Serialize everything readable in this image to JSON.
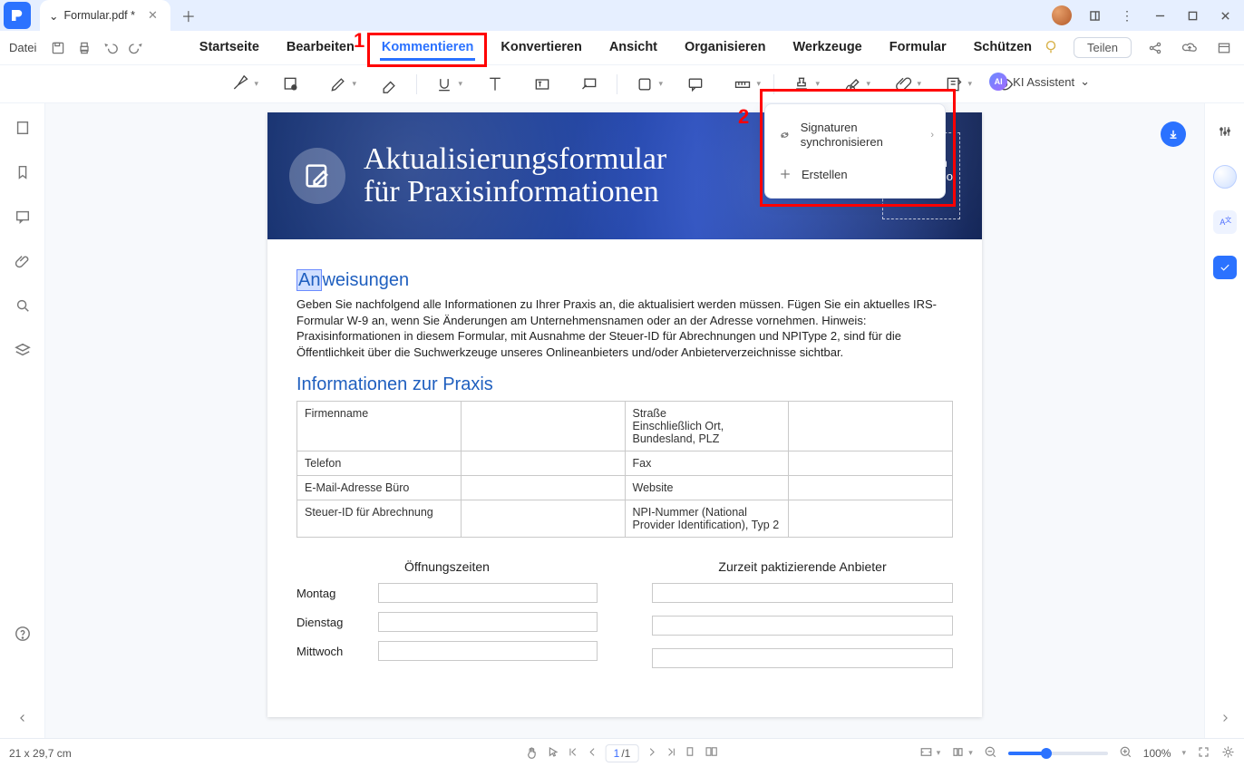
{
  "titlebar": {
    "tab_title": "Formular.pdf *"
  },
  "quickbar": {
    "file_label": "Datei",
    "share_label": "Teilen"
  },
  "menu": {
    "items": [
      "Startseite",
      "Bearbeiten",
      "Kommentieren",
      "Konvertieren",
      "Ansicht",
      "Organisieren",
      "Werkzeuge",
      "Formular",
      "Schützen"
    ],
    "active": "Kommentieren"
  },
  "ai_assistant": {
    "badge": "AI",
    "label": "KI Assistent",
    "caret": "⌄"
  },
  "annotations": {
    "num1": "1",
    "num2": "2"
  },
  "signature_popup": {
    "sync_label": "Signaturen synchronisieren",
    "create_label": "Erstellen"
  },
  "document": {
    "banner": {
      "title_line1": "Aktualisierungsformular",
      "title_line2": "für Praxisinformationen",
      "logo_box": "Platzieren Sie Ihr Logo hier"
    },
    "instructions": {
      "heading_pre": "An",
      "heading_rest": "weisungen",
      "body": "Geben Sie nachfolgend alle Informationen zu Ihrer Praxis an, die aktualisiert werden müssen. Fügen Sie ein aktuelles IRS-Formular W-9 an, wenn Sie Änderungen am Unternehmensnamen oder an der Adresse vornehmen. Hinweis: Praxisinformationen in diesem Formular, mit Ausnahme der Steuer-ID für Abrechnungen und NPIType 2, sind für die Öffentlichkeit über die Suchwerkzeuge unseres Onlineanbieters und/oder Anbieterverzeichnisse sichtbar."
    },
    "practice": {
      "heading": "Informationen zur Praxis",
      "rows": [
        {
          "l1": "Firmenname",
          "l2": "Straße\nEinschließlich Ort, Bundesland, PLZ"
        },
        {
          "l1": "Telefon",
          "l2": "Fax"
        },
        {
          "l1": "E-Mail-Adresse Büro",
          "l2": "Website"
        },
        {
          "l1": "Steuer-ID für Abrechnung",
          "l2": "NPI-Nummer (National Provider Identification), Typ 2"
        }
      ]
    },
    "hours_heading": "Öffnungszeiten",
    "providers_heading": "Zurzeit paktizierende Anbieter",
    "days": [
      "Montag",
      "Dienstag",
      "Mittwoch"
    ]
  },
  "statusbar": {
    "page_size": "21 x 29,7 cm",
    "page_current": "1",
    "page_sep": "/1",
    "zoom": "100%"
  }
}
